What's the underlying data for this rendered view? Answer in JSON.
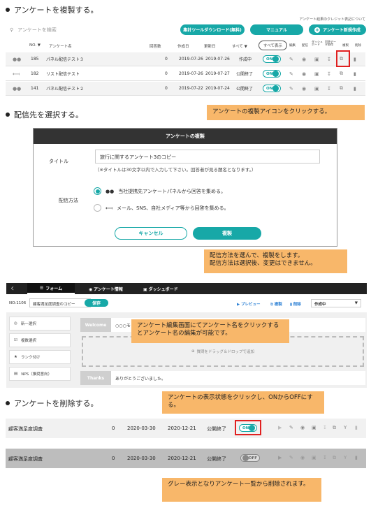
{
  "sections": {
    "copy": "アンケートを複製する。",
    "target": "配信先を選択する。",
    "delete": "アンケートを削除する。"
  },
  "list": {
    "credit_link": "アンケート結果のクレジット表記について",
    "search_placeholder": "アンケートを検索",
    "btn_download": "集計ツールダウンロード(無料)",
    "btn_manual": "マニュアル",
    "btn_new": "アンケート新規作成",
    "headers": {
      "no": "NO.",
      "name": "アンケート名",
      "responses": "回答数",
      "created": "作成日",
      "updated": "更新日",
      "all": "すべて",
      "show_all": "すべて表示",
      "edit": "編集",
      "deliver": "配信",
      "dashboard": "ダッシュボード",
      "download": "回答データ取得",
      "copy": "複製",
      "delete": "削除"
    },
    "rows": [
      {
        "no": "185",
        "name": "パネル配信テスト３",
        "responses": "0",
        "created": "2019-07-26",
        "updated": "2019-07-26",
        "status": "作成中",
        "toggle": "ON"
      },
      {
        "no": "182",
        "name": "リスト配信テスト",
        "responses": "0",
        "created": "2019-07-26",
        "updated": "2019-07-27",
        "status": "公開終了",
        "toggle": "ON"
      },
      {
        "no": "141",
        "name": "パネル配信テスト２",
        "responses": "0",
        "created": "2019-07-22",
        "updated": "2019-07-24",
        "status": "公開終了",
        "toggle": "ON"
      }
    ],
    "callout": "アンケートの複製アイコンをクリックする。"
  },
  "modal": {
    "header": "アンケートの複製",
    "title_label": "タイトル",
    "title_value": "旅行に関するアンケート3のコピー",
    "title_note": "（※タイトルは30文字以内で入力して下さい。回答者が見る題名となります。）",
    "method_label": "配信方法",
    "option_panel": "当社提携先アンケートパネルから回答を集める。",
    "option_email": "メール、SNS、自社メディア等から回答を集める。",
    "cancel": "キャンセル",
    "copy": "複製",
    "callout_line1": "配信方法を選んで、複製をします。",
    "callout_line2": "配信方法は選択後、変更はできません。"
  },
  "editor": {
    "tab_back": "く",
    "tab_form": "フォーム",
    "tab_info": "アンケート情報",
    "tab_dashboard": "ダッシュボード",
    "no_label": "NO:1106",
    "name_value": "顧客満足度調査のコピー",
    "save": "保存",
    "preview": "プレビュー",
    "copy": "複製",
    "delete": "削除",
    "status": "作成中",
    "side_items": [
      "新一選択",
      "複数選択",
      "ランク付け",
      "NPS（推奨意向）"
    ],
    "welcome": "Welcome",
    "welcome_text": "○○○モ",
    "drop_text": "質問をドラッグ＆ドロップで追加",
    "thanks": "Thanks",
    "thanks_text": "ありがとうございました。",
    "callout": "アンケート編集画面にてアンケート名をクリックするとアンケート名の編集が可能です。"
  },
  "delete_section": {
    "callout_top": "アンケートの表示状態をクリックし、ONからOFFにする。",
    "callout_bottom": "グレー表示となりアンケート一覧から削除されます。",
    "rows": [
      {
        "name": "顧客満足度調査",
        "responses": "0",
        "created": "2020-03-30",
        "updated": "2020-12-21",
        "status": "公開終了",
        "toggle": "ON"
      },
      {
        "name": "顧客満足度調査",
        "responses": "0",
        "created": "2020-03-30",
        "updated": "2020-12-21",
        "status": "公開終了",
        "toggle": "OFF"
      }
    ]
  },
  "colors": {
    "accent": "#17a8a7",
    "callout": "#f8b76a",
    "highlight": "#e02020",
    "modal_header": "#333333"
  }
}
